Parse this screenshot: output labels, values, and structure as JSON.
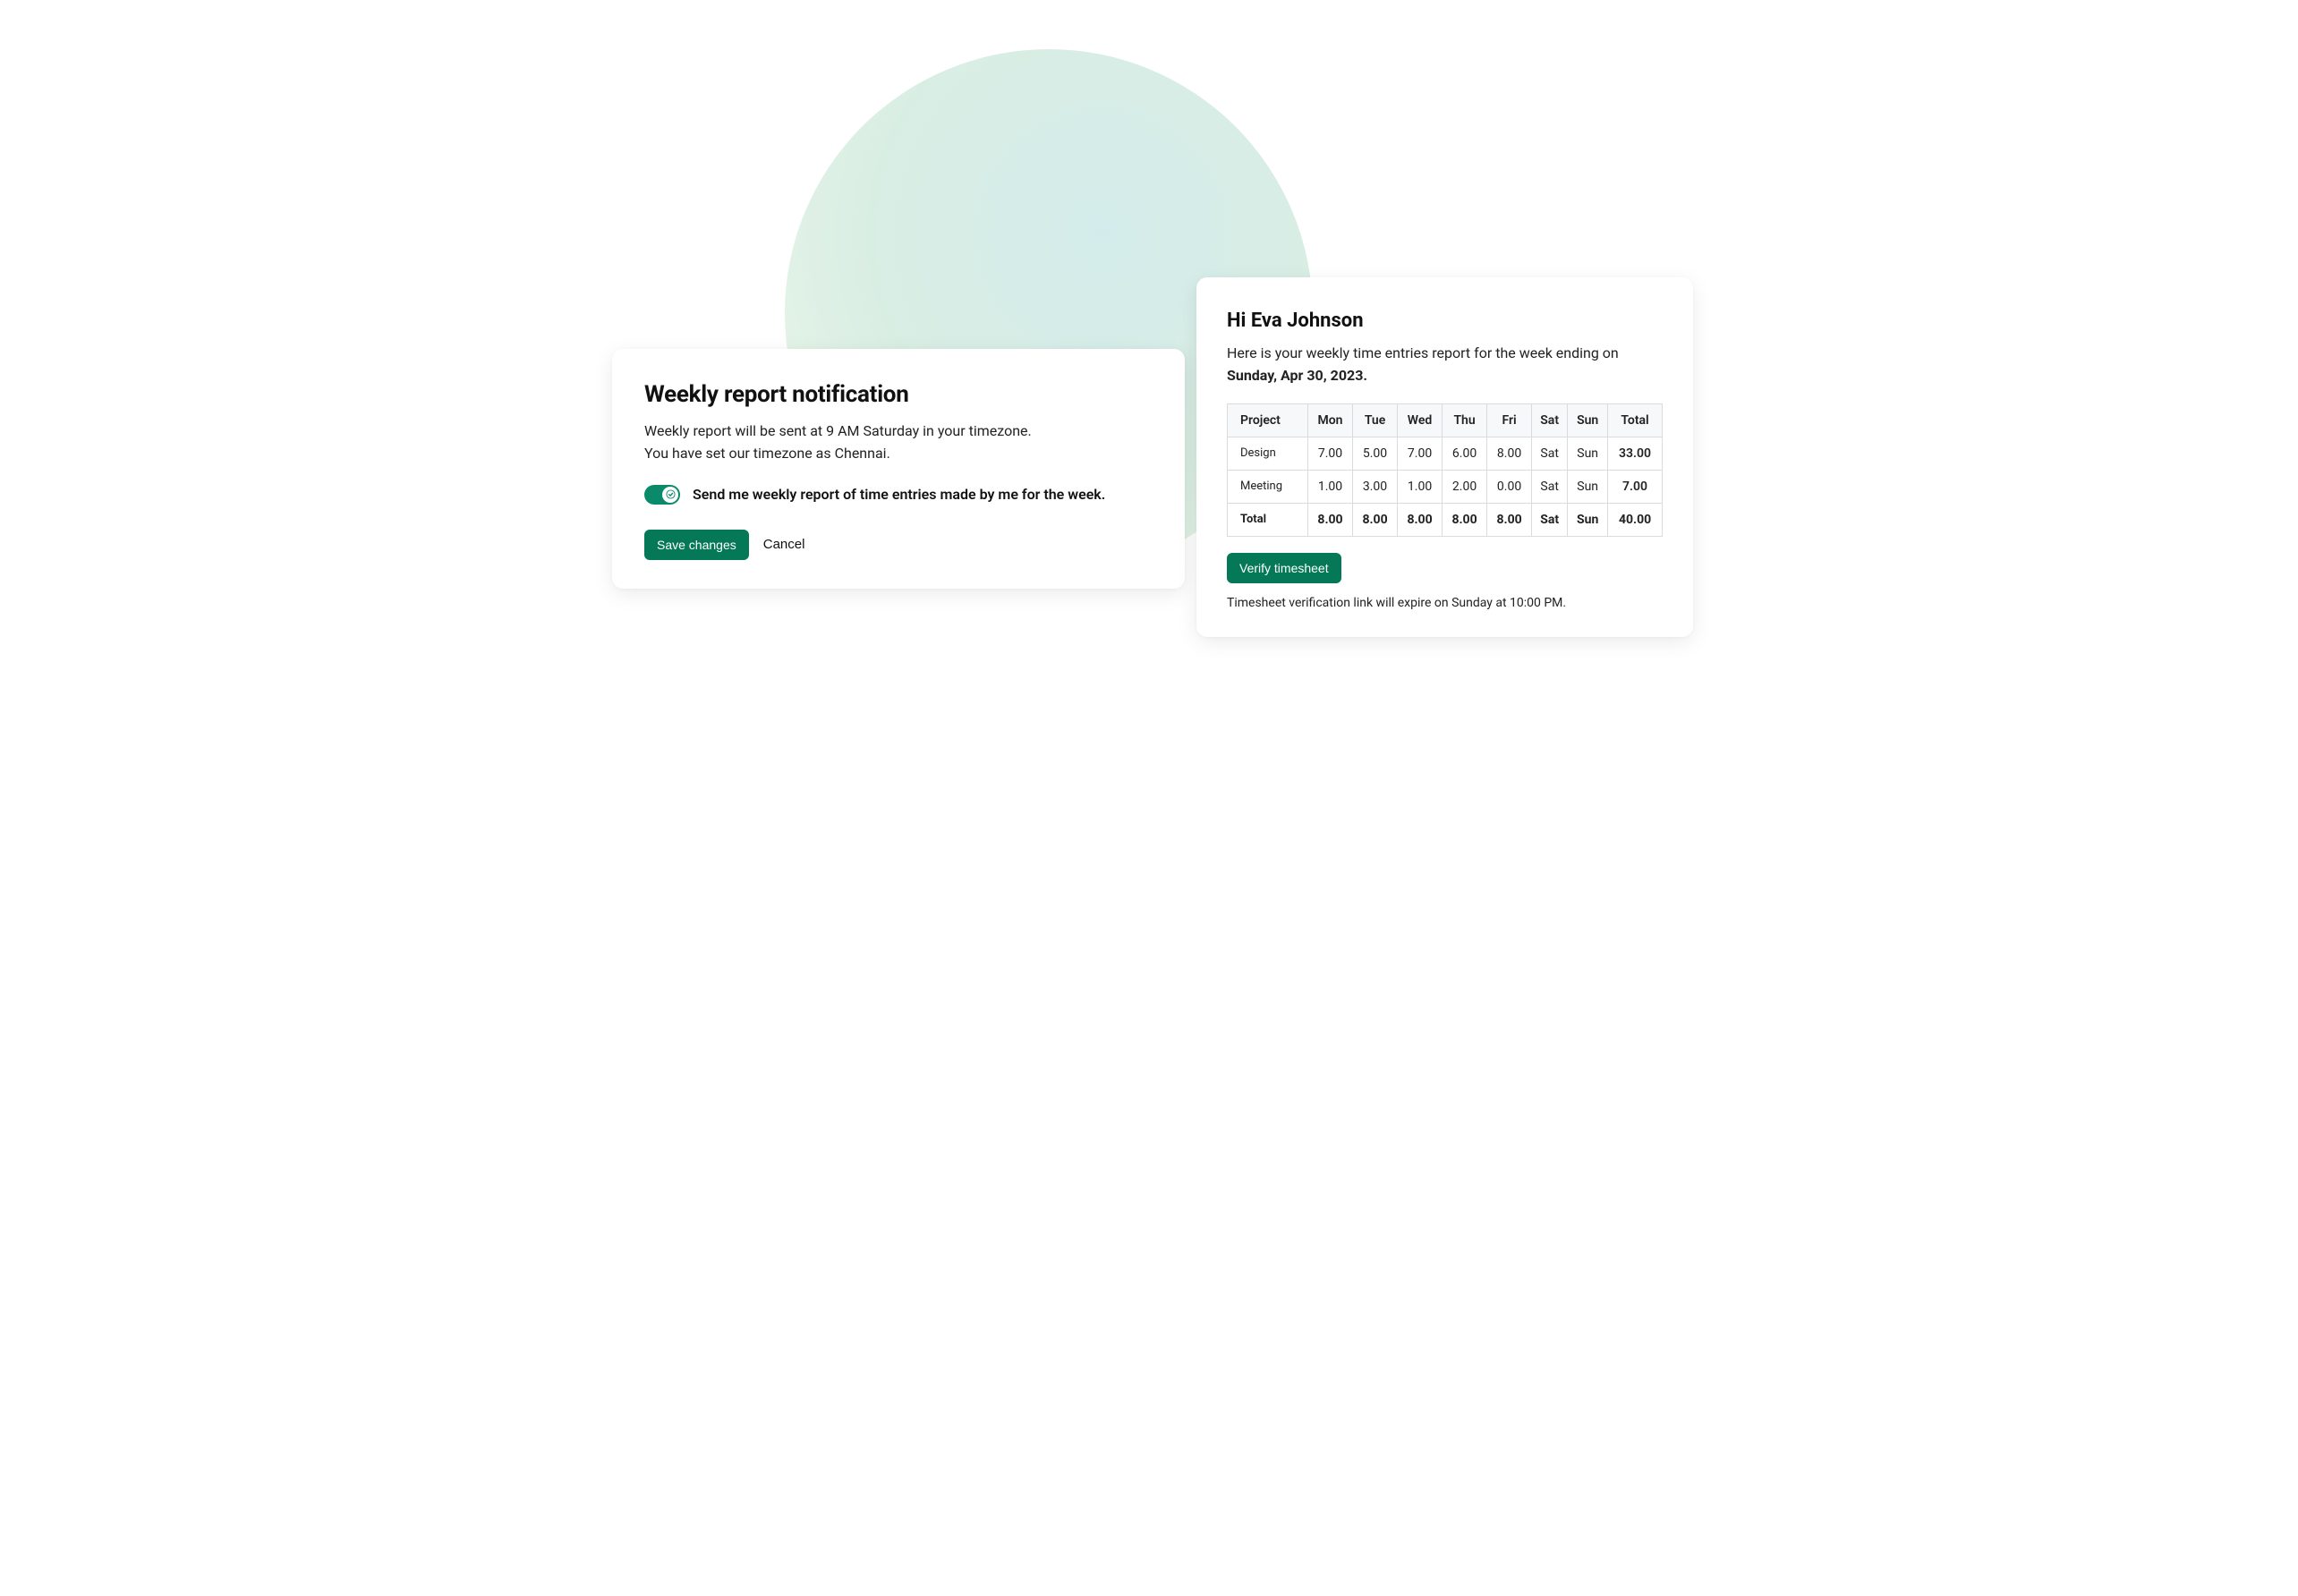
{
  "settings_card": {
    "title": "Weekly report notification",
    "description_line1": "Weekly report will be sent at 9 AM Saturday in your timezone.",
    "description_line2": "You have set our timezone as Chennai.",
    "toggle_label": "Send me weekly report of time entries made by me for the week.",
    "toggle_on": true,
    "save_button": "Save changes",
    "cancel_button": "Cancel"
  },
  "report_card": {
    "greeting": "Hi Eva Johnson",
    "subtext_prefix": "Here is your weekly time entries report for the week ending on ",
    "week_ending": "Sunday, Apr 30, 2023.",
    "table": {
      "headers": [
        "Project",
        "Mon",
        "Tue",
        "Wed",
        "Thu",
        "Fri",
        "Sat",
        "Sun",
        "Total"
      ],
      "rows": [
        {
          "project": "Design",
          "cells": [
            "7.00",
            "5.00",
            "7.00",
            "6.00",
            "8.00",
            "Sat",
            "Sun",
            "33.00"
          ]
        },
        {
          "project": "Meeting",
          "cells": [
            "1.00",
            "3.00",
            "1.00",
            "2.00",
            "0.00",
            "Sat",
            "Sun",
            "7.00"
          ]
        }
      ],
      "total_row": {
        "project": "Total",
        "cells": [
          "8.00",
          "8.00",
          "8.00",
          "8.00",
          "8.00",
          "Sat",
          "Sun",
          "40.00"
        ]
      }
    },
    "verify_button": "Verify timesheet",
    "expire_note": "Timesheet verification link will expire on Sunday at 10:00 PM."
  },
  "colors": {
    "primary": "#047857",
    "toggle": "#0a8a6a"
  }
}
